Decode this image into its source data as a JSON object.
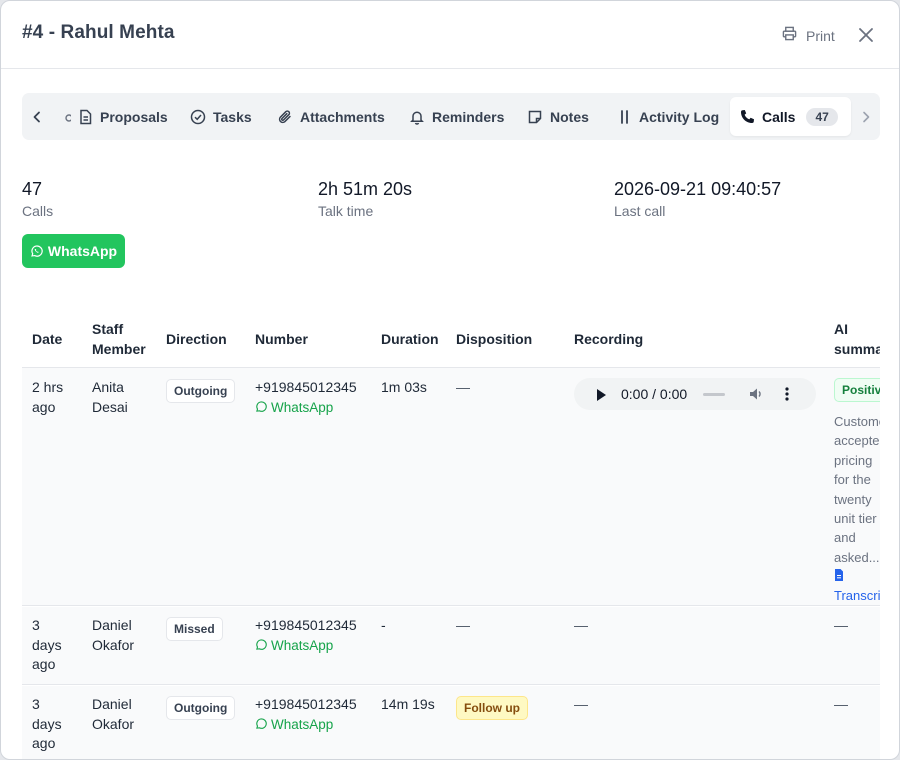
{
  "modal": {
    "title": "#4 - Rahul Mehta",
    "print_label": "Print"
  },
  "tabs": {
    "items": [
      {
        "label": "Proposals",
        "icon": "document-icon"
      },
      {
        "label": "Tasks",
        "icon": "check-circle-icon"
      },
      {
        "label": "Attachments",
        "icon": "paperclip-icon"
      },
      {
        "label": "Reminders",
        "icon": "bell-icon"
      },
      {
        "label": "Notes",
        "icon": "note-icon"
      },
      {
        "label": "Activity Log",
        "icon": "activity-icon"
      },
      {
        "label": "Calls",
        "icon": "phone-icon",
        "count": "47",
        "active": true
      }
    ]
  },
  "stats": {
    "calls": {
      "value": "47",
      "label": "Calls"
    },
    "talk_time": {
      "value": "2h 51m 20s",
      "label": "Talk time"
    },
    "last_call": {
      "value": "2026-09-21 09:40:57",
      "label": "Last call"
    }
  },
  "whatsapp_button": "WhatsApp",
  "table": {
    "headers": {
      "date": "Date",
      "staff": "Staff Member",
      "direction": "Direction",
      "number": "Number",
      "duration": "Duration",
      "disposition": "Disposition",
      "recording": "Recording",
      "ai_summary": "AI summary"
    },
    "rows": [
      {
        "date": "2 hrs ago",
        "staff": "Anita Desai",
        "direction": "Outgoing",
        "number": "+919845012345",
        "whatsapp": "WhatsApp",
        "duration": "1m 03s",
        "disposition": "—",
        "recording_time": "0:00 / 0:00",
        "ai_sentiment": "Positive",
        "ai_summary": "Customer accepted pricing for the twenty unit tier and asked...",
        "transcript": "Transcript"
      },
      {
        "date": "3 days ago",
        "staff": "Daniel Okafor",
        "direction": "Missed",
        "number": "+919845012345",
        "whatsapp": "WhatsApp",
        "duration": "-",
        "disposition": "—",
        "recording": "—",
        "ai_summary": "—"
      },
      {
        "date": "3 days ago",
        "staff": "Daniel Okafor",
        "direction": "Outgoing",
        "number": "+919845012345",
        "whatsapp": "WhatsApp",
        "duration": "14m 19s",
        "disposition": "Follow up",
        "recording": "—",
        "ai_summary": "—"
      }
    ]
  }
}
